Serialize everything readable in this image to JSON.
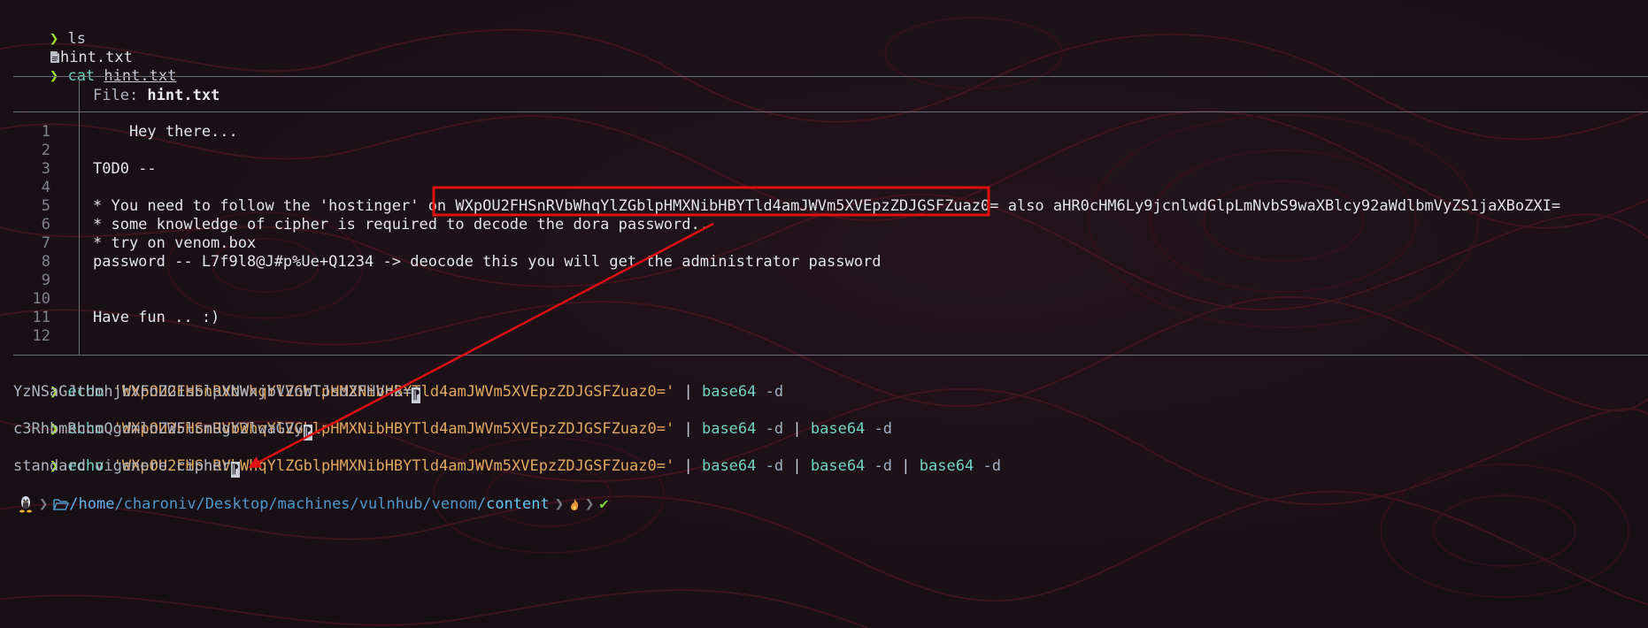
{
  "terminal": {
    "prompt_symbol": "❯",
    "cmd1": "ls",
    "ls_output": "hint.txt",
    "cmd2_bin": "cat",
    "cmd2_arg": "hint.txt",
    "file_header_label": "File: ",
    "file_header_name": "hint.txt",
    "file_lines": [
      {
        "num": "1",
        "text": "    Hey there..."
      },
      {
        "num": "2",
        "text": ""
      },
      {
        "num": "3",
        "text": "T0D0 --"
      },
      {
        "num": "4",
        "text": ""
      },
      {
        "num": "5",
        "text": "* You need to follow the 'hostinger' on WXpOU2FHSnRVbWhqYlZGblpHMXNibHBYTld4amJWVm5XVEpzZDJGSFZuaz0= also aHR0cHM6Ly9jcnlwdGlpLmNvbS9waXBlcy92aWdlbmVyZS1jaXBoZXI="
      },
      {
        "num": "6",
        "text": "* some knowledge of cipher is required to decode the dora password.."
      },
      {
        "num": "7",
        "text": "* try on venom.box"
      },
      {
        "num": "8",
        "text": "password -- L7f9l8@J#p%Ue+Q1234 -> deocode this you will get the administrator password"
      },
      {
        "num": "9",
        "text": ""
      },
      {
        "num": "10",
        "text": ""
      },
      {
        "num": "11",
        "text": "Have fun .. :)"
      },
      {
        "num": "12",
        "text": ""
      }
    ],
    "echo_cmd": "echo",
    "echo_str": "'WXpOU2FHSnRVbWhqYlZGblpHMXNibHBYTld4amJWVm5XVEpzZDJGSFZuaz0='",
    "pipe": "|",
    "base64": "base64",
    "flag_d": "-d",
    "out1": "YzNSaGJtUmhjbVFnZG1sblpXNWxjbVVnWTJsd2FHVnk=",
    "out2": "c3RhbmRhcmQgdmlnZW5lcmUgY2lwaGVy",
    "out3": "standard vigenere cipher",
    "cursor_glyph": "⁋",
    "path_home": "/home",
    "path_rest": "/charoniv/Desktop/machines/vulnhub/venom/",
    "path_last": "content",
    "check": "✔"
  },
  "colors": {
    "background": "#1b1218",
    "prompt": "#a6e22e",
    "string": "#e0a85f",
    "binary": "#6fd3c4",
    "annotation": "#e01010"
  }
}
